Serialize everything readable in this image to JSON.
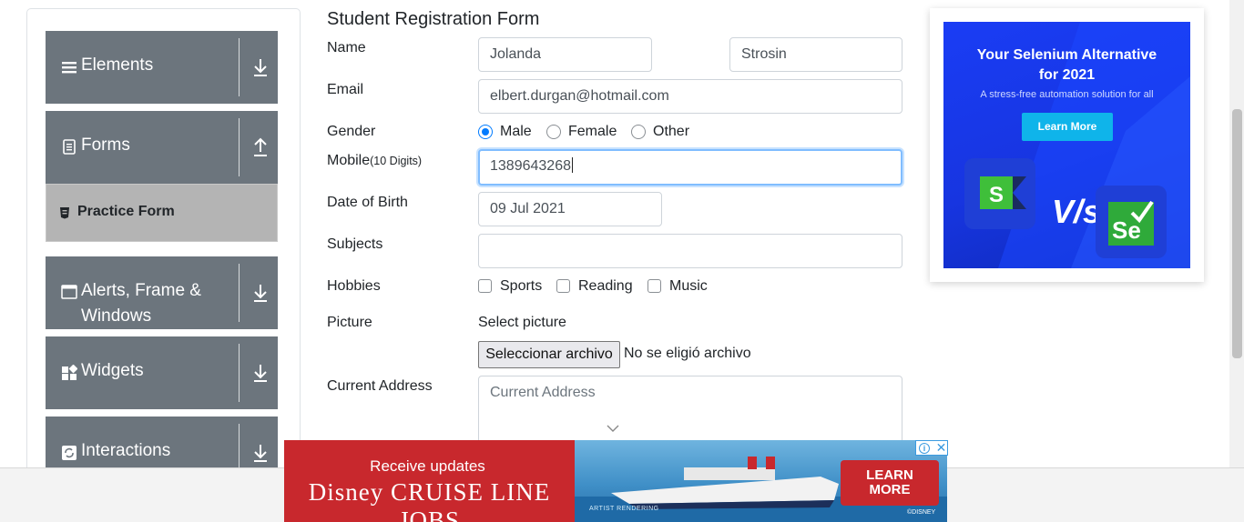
{
  "sidebar": {
    "groups": [
      {
        "label": "Elements",
        "icon": "hamburger-icon",
        "arrow": "download-arrow-icon"
      },
      {
        "label": "Forms",
        "icon": "document-icon",
        "arrow": "upload-arrow-icon"
      },
      {
        "label_line1": "Alerts, Frame &",
        "label_line2": "Windows",
        "icon": "window-icon",
        "arrow": "download-arrow-icon"
      },
      {
        "label": "Widgets",
        "icon": "grid-icon",
        "arrow": "download-arrow-icon"
      },
      {
        "label": "Interactions",
        "icon": "refresh-icon",
        "arrow": "download-arrow-icon"
      }
    ],
    "active_item": "Practice Form"
  },
  "form": {
    "title": "Student Registration Form",
    "name_label": "Name",
    "first_name": "Jolanda",
    "last_name": "Strosin",
    "email_label": "Email",
    "email": "elbert.durgan@hotmail.com",
    "gender_label": "Gender",
    "genders": [
      "Male",
      "Female",
      "Other"
    ],
    "gender_selected": "Male",
    "mobile_label": "Mobile",
    "mobile_hint": "(10 Digits)",
    "mobile": "1389643268",
    "dob_label": "Date of Birth",
    "dob": "09 Jul 2021",
    "subjects_label": "Subjects",
    "hobbies_label": "Hobbies",
    "hobbies": [
      "Sports",
      "Reading",
      "Music"
    ],
    "picture_label": "Picture",
    "select_picture": "Select picture",
    "file_button": "Seleccionar archivo",
    "file_status": "No se eligió archivo",
    "address_label": "Current Address",
    "address_placeholder": "Current Address"
  },
  "ad_right": {
    "title_line1": "Your Selenium Alternative",
    "title_line2": "for 2021",
    "subtitle": "A stress-free automation solution for all",
    "button": "Learn More",
    "vs": "V/s",
    "logo_right": "Se"
  },
  "ad_bottom": {
    "line1": "Receive updates",
    "line2": "Disney CRUISE LINE JOBS",
    "button_line1": "LEARN",
    "button_line2": "MORE",
    "caption": "ARTIST RENDERING",
    "copyright": "©DISNEY"
  },
  "colors": {
    "sidebar_header": "#6c757d",
    "active_item": "#b4b4b4",
    "accent": "#007bff",
    "focus_border": "#80bdff",
    "ad_blue": "#1a3df5",
    "banner_red": "#c8282d"
  }
}
